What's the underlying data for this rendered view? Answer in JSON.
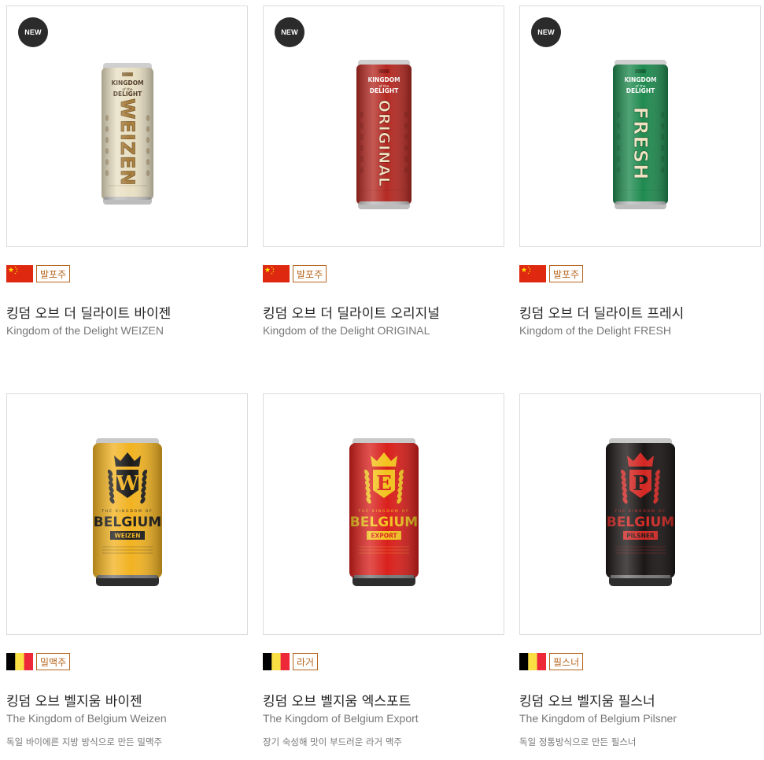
{
  "products": [
    {
      "badge": "NEW",
      "flag": "china",
      "tag": "발포주",
      "name_ko": "킹덤 오브 더 딜라이트 바이젠",
      "name_en": "Kingdom of the Delight WEIZEN",
      "desc": "",
      "can": {
        "style": "tall",
        "body": "#e9e0c4",
        "accent": "#7a5a2a",
        "text": "WEIZEN",
        "brand_top": "KINGDOM",
        "brand_mid": "of the",
        "brand_bot": "DELIGHT",
        "label_color": "#a77d3c"
      }
    },
    {
      "badge": "NEW",
      "flag": "china",
      "tag": "발포주",
      "name_ko": "킹덤 오브 더 딜라이트 오리지널",
      "name_en": "Kingdom of the Delight ORIGINAL",
      "desc": "",
      "can": {
        "style": "tall",
        "body": "#b42a23",
        "accent": "#7a1410",
        "text": "ORIGINAL",
        "brand_top": "KINGDOM",
        "brand_mid": "of the",
        "brand_bot": "DELIGHT",
        "label_color": "#f0e2c0"
      }
    },
    {
      "badge": "NEW",
      "flag": "china",
      "tag": "발포주",
      "name_ko": "킹덤 오브 더 딜라이트 프레시",
      "name_en": "Kingdom of the Delight FRESH",
      "desc": "",
      "can": {
        "style": "tall",
        "body": "#1f8a4f",
        "accent": "#0f5a31",
        "text": "FRESH",
        "brand_top": "KINGDOM",
        "brand_mid": "of the",
        "brand_bot": "DELIGHT",
        "label_color": "#f0e2c0"
      }
    },
    {
      "badge": "",
      "flag": "belgium",
      "tag": "밀맥주",
      "name_ko": "킹덤 오브 벨지움 바이젠",
      "name_en": "The Kingdom of Belgium Weizen",
      "desc": "독일 바이에른 지방 방식으로 만든 밀맥주",
      "can": {
        "style": "short",
        "body": "#f2b322",
        "accent": "#1a1a1a",
        "letter": "W",
        "brand_top": "THE KINGDOM OF",
        "brand_bot": "BELGIUM",
        "variant": "WEIZEN",
        "label_color": "#1a1a1a",
        "variant_bg": "#1a1a1a",
        "variant_fg": "#f2b322"
      }
    },
    {
      "badge": "",
      "flag": "belgium",
      "tag": "라거",
      "name_ko": "킹덤 오브 벨지움 엑스포트",
      "name_en": "The Kingdom of Belgium Export",
      "desc": "장기 숙성해 맛이 부드러운 라거 맥주",
      "can": {
        "style": "short",
        "body": "#d9201c",
        "accent": "#f3c21d",
        "letter": "E",
        "brand_top": "THE KINGDOM OF",
        "brand_bot": "BELGIUM",
        "variant": "EXPORT",
        "label_color": "#f3c21d",
        "variant_bg": "#f3c21d",
        "variant_fg": "#d9201c"
      }
    },
    {
      "badge": "",
      "flag": "belgium",
      "tag": "필스너",
      "name_ko": "킹덤 오브 벨지움 필스너",
      "name_en": "The Kingdom of Belgium Pilsner",
      "desc": "독일 정통방식으로 만든 필스너",
      "can": {
        "style": "short",
        "body": "#1c1717",
        "accent": "#d32622",
        "letter": "P",
        "brand_top": "THE KINGDOM OF",
        "brand_bot": "BELGIUM",
        "variant": "PILSNER",
        "label_color": "#d32622",
        "variant_bg": "#d32622",
        "variant_fg": "#1c1717"
      }
    }
  ],
  "colors": {
    "tag_border": "#b5651d",
    "badge_bg": "#2b2b2b",
    "china_red": "#de2910",
    "china_yellow": "#ffde00",
    "belgium_black": "#000000",
    "belgium_yellow": "#fae042",
    "belgium_red": "#ed2939"
  }
}
